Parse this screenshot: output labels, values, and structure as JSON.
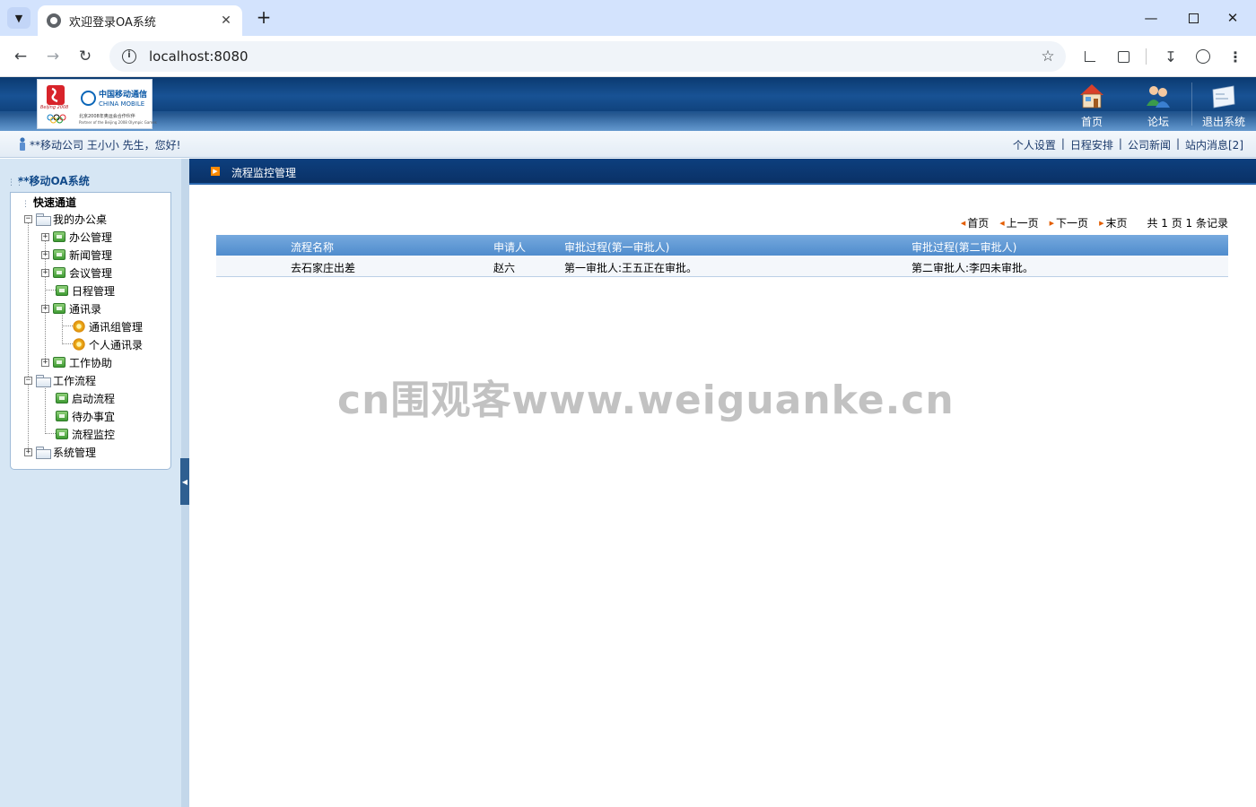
{
  "browser": {
    "tab_title": "欢迎登录OA系统",
    "url": "localhost:8080",
    "icons": [
      "chevron-down-icon",
      "globe-icon",
      "close-icon",
      "plus-icon",
      "back-icon",
      "forward-icon",
      "reload-icon",
      "info-icon",
      "star-icon",
      "screenshot-icon",
      "extensions-icon",
      "download-icon",
      "account-icon",
      "more-icon",
      "minimize-icon",
      "maximize-icon",
      "close-window-icon"
    ]
  },
  "header": {
    "logo": {
      "beijing_text": "Beijing 2008",
      "brand_cn": "中国移动通信",
      "brand_en": "CHINA MOBILE",
      "partner_cn": "北京2008年奥运会合作伙伴",
      "partner_en": "Partner of the Beijing 2008 Olympic Games"
    },
    "buttons": [
      {
        "label": "首页",
        "icon": "house-icon"
      },
      {
        "label": "论坛",
        "icon": "users-icon"
      },
      {
        "label": "退出系统",
        "icon": "exit-card-icon"
      }
    ]
  },
  "welcome": {
    "text": "**移动公司 王小小 先生，您好!",
    "links": [
      "个人设置",
      "日程安排",
      "公司新闻",
      "站内消息[2]"
    ],
    "separator": "|"
  },
  "sidebar": {
    "title": "**移动OA系统",
    "quick": "快速通道",
    "tree": {
      "my_office": "我的办公桌",
      "office_mgmt": "办公管理",
      "news_mgmt": "新闻管理",
      "meeting_mgmt": "会议管理",
      "schedule_mgmt": "日程管理",
      "contacts": "通讯录",
      "contact_group": "通讯组管理",
      "personal_contacts": "个人通讯录",
      "work_assist": "工作协助",
      "workflow": "工作流程",
      "start_flow": "启动流程",
      "todo": "待办事宜",
      "flow_monitor": "流程监控",
      "system_mgmt": "系统管理"
    }
  },
  "main": {
    "title": "流程监控管理",
    "pager": {
      "first": "首页",
      "prev": "上一页",
      "next": "下一页",
      "last": "末页",
      "summary": "共 1 页 1 条记录"
    },
    "table": {
      "headers": [
        "流程名称",
        "申请人",
        "审批过程(第一审批人)",
        "审批过程(第二审批人)"
      ],
      "rows": [
        [
          "去石家庄出差",
          "赵六",
          "第一审批人:王五正在审批。",
          "第二审批人:李四未审批。"
        ]
      ]
    }
  },
  "watermark": "cn围观客www.weiguanke.cn",
  "colors": {
    "header_blue": "#0e3f78",
    "grid_header": "#5b95d3",
    "pager_arrow": "#e35d00",
    "title_arrow": "#ff8a00"
  }
}
